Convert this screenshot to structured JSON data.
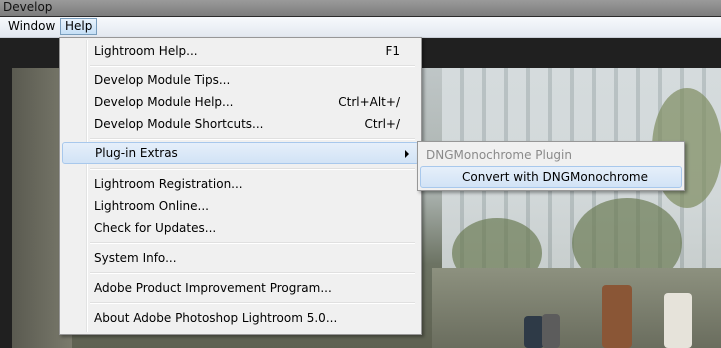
{
  "window": {
    "title": "Develop"
  },
  "menubar": {
    "items": [
      {
        "label": "Window"
      },
      {
        "label": "Help"
      }
    ]
  },
  "help_menu": {
    "items": [
      {
        "label": "Lightroom Help...",
        "shortcut": "F1"
      },
      {
        "label": "Develop Module Tips...",
        "shortcut": ""
      },
      {
        "label": "Develop Module Help...",
        "shortcut": "Ctrl+Alt+/"
      },
      {
        "label": "Develop Module Shortcuts...",
        "shortcut": "Ctrl+/"
      },
      {
        "label": "Plug-in Extras",
        "shortcut": ""
      },
      {
        "label": "Lightroom Registration...",
        "shortcut": ""
      },
      {
        "label": "Lightroom Online...",
        "shortcut": ""
      },
      {
        "label": "Check for Updates...",
        "shortcut": ""
      },
      {
        "label": "System Info...",
        "shortcut": ""
      },
      {
        "label": "Adobe Product Improvement Program...",
        "shortcut": ""
      },
      {
        "label": "About Adobe Photoshop Lightroom 5.0...",
        "shortcut": ""
      }
    ]
  },
  "plugin_submenu": {
    "header": "DNGMonochrome Plugin",
    "items": [
      {
        "label": "Convert with DNGMonochrome"
      }
    ]
  }
}
